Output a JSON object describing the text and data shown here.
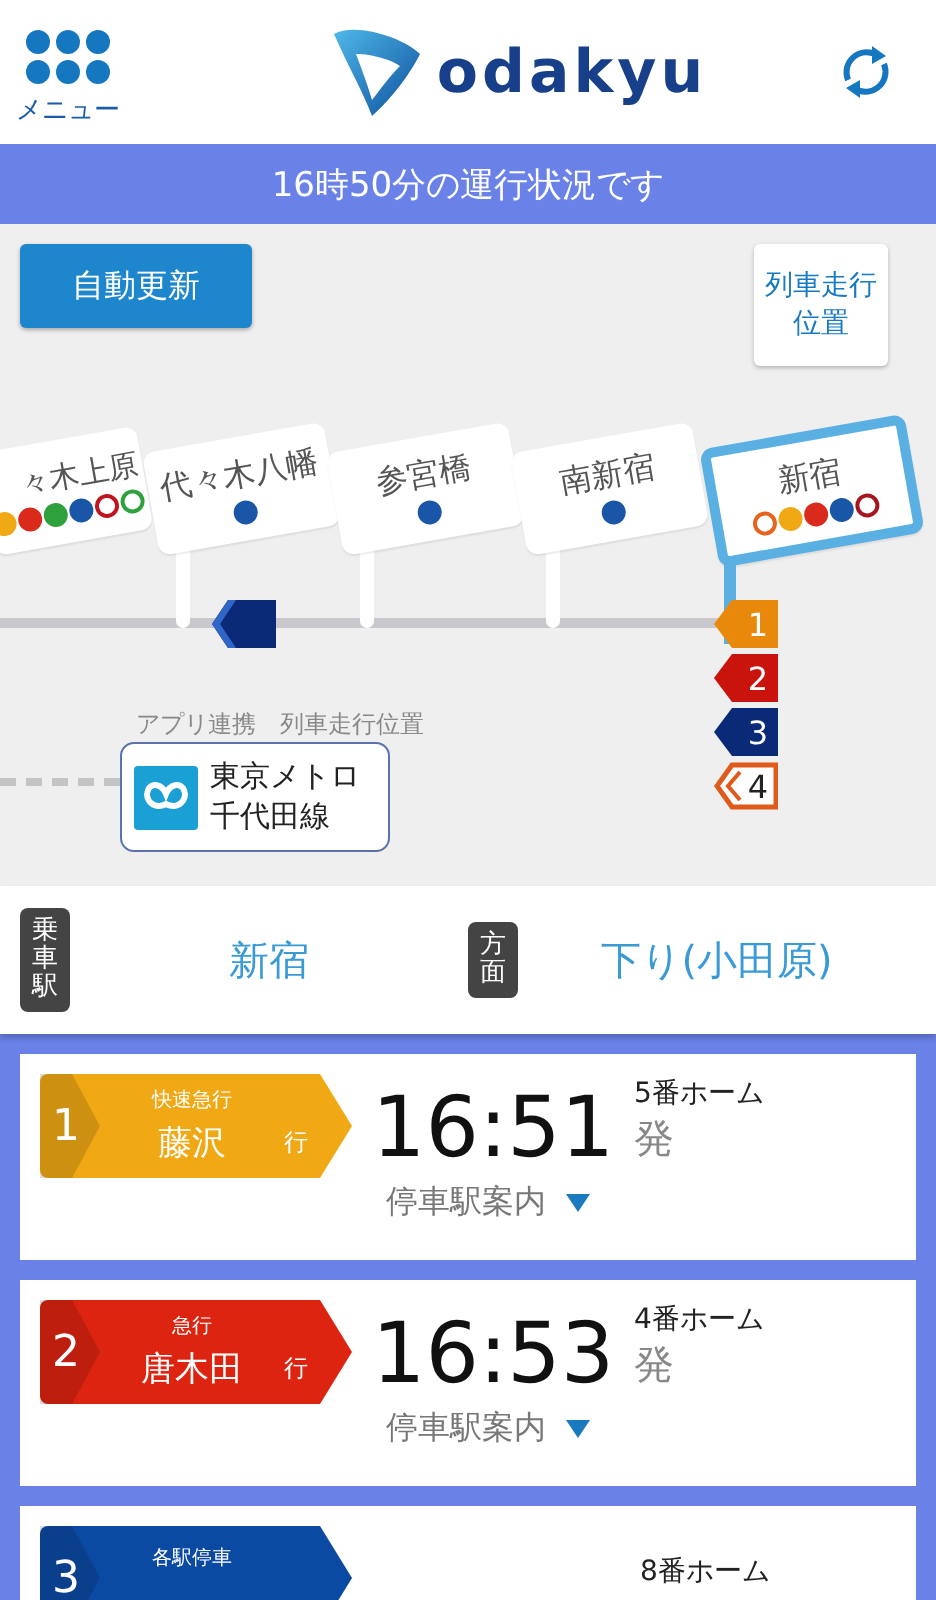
{
  "header": {
    "menu_label": "メニュー",
    "logo_text": "odakyu"
  },
  "status": "16時50分の運行状況です",
  "map": {
    "auto_update_button": "自動更新",
    "position_button": "列車走行位置",
    "stations": [
      {
        "name": "々木上原",
        "selected": false,
        "dots": [
          {
            "kind": "dot",
            "color": "#f0a814"
          },
          {
            "kind": "dot",
            "color": "#d92a1c"
          },
          {
            "kind": "dot",
            "color": "#2ea03c"
          },
          {
            "kind": "dot",
            "color": "#1a56a8"
          },
          {
            "kind": "ring",
            "color": "#c0141e"
          },
          {
            "kind": "ring",
            "color": "#2ea03c"
          }
        ]
      },
      {
        "name": "代々木八幡",
        "selected": false,
        "dots": [
          {
            "kind": "dot",
            "color": "#1a56a8"
          }
        ]
      },
      {
        "name": "参宮橋",
        "selected": false,
        "dots": [
          {
            "kind": "dot",
            "color": "#1a56a8"
          }
        ]
      },
      {
        "name": "南新宿",
        "selected": false,
        "dots": [
          {
            "kind": "dot",
            "color": "#1a56a8"
          }
        ]
      },
      {
        "name": "新宿",
        "selected": true,
        "dots": [
          {
            "kind": "ring",
            "color": "#e8641c"
          },
          {
            "kind": "dot",
            "color": "#f0a814"
          },
          {
            "kind": "dot",
            "color": "#d92a1c"
          },
          {
            "kind": "dot",
            "color": "#1a56a8"
          },
          {
            "kind": "ring",
            "color": "#a8141e"
          }
        ]
      }
    ],
    "moving_trains": [
      {
        "color": "#0a2a78"
      }
    ],
    "arrived_trains": [
      {
        "number": "1",
        "kind": "solid",
        "color": "#e8890c"
      },
      {
        "number": "2",
        "kind": "solid",
        "color": "#c8140c"
      },
      {
        "number": "3",
        "kind": "solid",
        "color": "#0a2a78"
      },
      {
        "number": "4",
        "kind": "outline",
        "color": "#e05a1c"
      }
    ],
    "link": {
      "caption": "アプリ連携　列車走行位置",
      "line_name": "東京メトロ千代田線"
    }
  },
  "selector": {
    "station_label": "乗車駅",
    "station": "新宿",
    "direction_label": "方面",
    "direction": "下り(小田原)"
  },
  "trains": [
    {
      "number": "1",
      "type": "快速急行",
      "destination": "藤沢",
      "suffix": "行",
      "time": "16:51",
      "platform": "5番ホーム",
      "departure": "発",
      "stops_link": "停車駅案内",
      "color": "#f0a814"
    },
    {
      "number": "2",
      "type": "急行",
      "destination": "唐木田",
      "suffix": "行",
      "time": "16:53",
      "platform": "4番ホーム",
      "departure": "発",
      "stops_link": "停車駅案内",
      "color": "#dc2410"
    },
    {
      "number": "3",
      "type": "各駅停車",
      "platform": "8番ホーム",
      "color": "#0b4aa2"
    }
  ]
}
